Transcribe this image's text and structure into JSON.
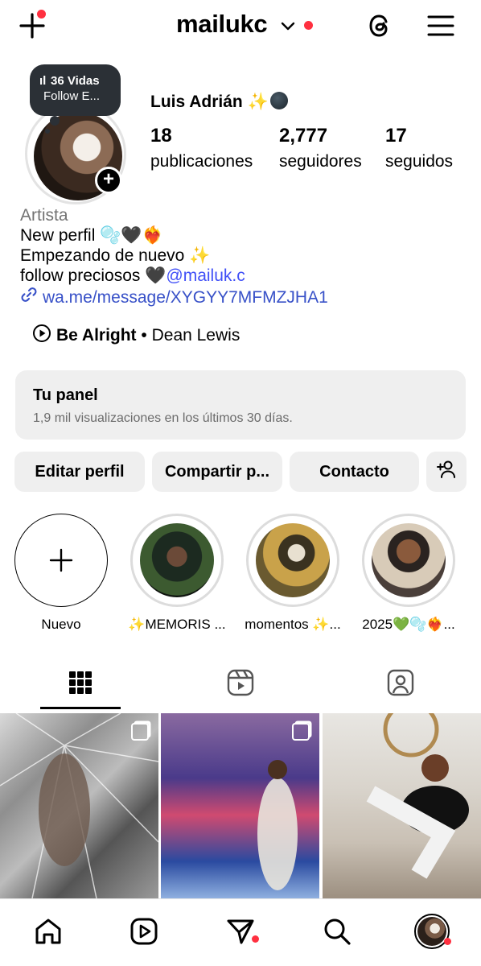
{
  "header": {
    "username": "mailukc",
    "icons": [
      "new-post-icon",
      "chevron-down-icon",
      "threads-icon",
      "menu-icon"
    ],
    "accent_color": "#ff3040"
  },
  "profile": {
    "note_line1": "36 Vidas",
    "note_line2": "Follow E...",
    "full_name": "Luis Adrián ✨",
    "stats": [
      {
        "value": "18",
        "label": "publicaciones"
      },
      {
        "value": "2,777",
        "label": "seguidores"
      },
      {
        "value": "17",
        "label": "seguidos"
      }
    ]
  },
  "bio": {
    "category": "Artista",
    "line1": "New perfil 🫧🖤❤️‍🔥",
    "line2": "Empezando de nuevo ✨",
    "line3_text": "follow preciosos 🖤",
    "line3_mention": "@mailuk.c",
    "link": "wa.me/message/XYGYY7MFMZJHA1",
    "link_color": "#3851c8",
    "mention_color": "#4150f7"
  },
  "music": {
    "song": "Be Alright",
    "separator": " • ",
    "artist": "Dean Lewis"
  },
  "panel": {
    "title": "Tu panel",
    "subtitle": "1,9 mil visualizaciones en los últimos 30 días."
  },
  "actions": {
    "edit": "Editar perfil",
    "share": "Compartir p...",
    "contact": "Contacto"
  },
  "highlights": [
    {
      "label": "Nuevo"
    },
    {
      "label": "✨MEMORIS ..."
    },
    {
      "label": "momentos ✨..."
    },
    {
      "label": "2025💚🫧❤️‍🔥..."
    }
  ],
  "tabs": [
    "grid-icon",
    "reels-icon",
    "tagged-icon"
  ],
  "nav": [
    "home-icon",
    "reels-icon",
    "messages-icon",
    "search-icon",
    "profile-avatar"
  ]
}
